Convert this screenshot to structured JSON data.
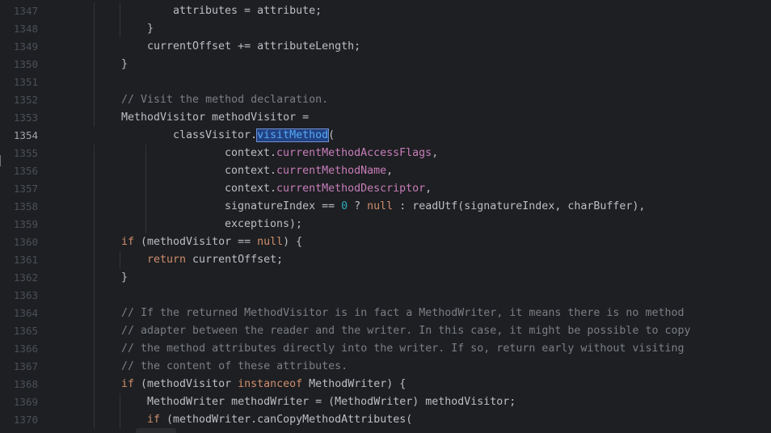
{
  "editor": {
    "current_line": 1354,
    "lines": [
      {
        "num": "1347",
        "indent": 4,
        "tokens": [
          {
            "t": "attributes = attribute;",
            "c": "plain"
          }
        ]
      },
      {
        "num": "1348",
        "indent": 3,
        "tokens": [
          {
            "t": "}",
            "c": "plain"
          }
        ]
      },
      {
        "num": "1349",
        "indent": 3,
        "tokens": [
          {
            "t": "currentOffset += attributeLength;",
            "c": "plain"
          }
        ]
      },
      {
        "num": "1350",
        "indent": 2,
        "tokens": [
          {
            "t": "}",
            "c": "plain"
          }
        ]
      },
      {
        "num": "1351",
        "indent": 0,
        "tokens": []
      },
      {
        "num": "1352",
        "indent": 2,
        "tokens": [
          {
            "t": "// Visit the method declaration.",
            "c": "cmt"
          }
        ]
      },
      {
        "num": "1353",
        "indent": 2,
        "tokens": [
          {
            "t": "MethodVisitor methodVisitor =",
            "c": "plain"
          }
        ]
      },
      {
        "num": "1354",
        "indent": 4,
        "tokens": [
          {
            "t": "classVisitor.",
            "c": "plain"
          },
          {
            "t": "visitMethod",
            "c": "sel"
          },
          {
            "t": "(",
            "c": "plain"
          }
        ]
      },
      {
        "num": "1355",
        "indent": 6,
        "tokens": [
          {
            "t": "context.",
            "c": "plain"
          },
          {
            "t": "currentMethodAccessFlags",
            "c": "field"
          },
          {
            "t": ",",
            "c": "plain"
          }
        ]
      },
      {
        "num": "1356",
        "indent": 6,
        "tokens": [
          {
            "t": "context.",
            "c": "plain"
          },
          {
            "t": "currentMethodName",
            "c": "field"
          },
          {
            "t": ",",
            "c": "plain"
          }
        ]
      },
      {
        "num": "1357",
        "indent": 6,
        "tokens": [
          {
            "t": "context.",
            "c": "plain"
          },
          {
            "t": "currentMethodDescriptor",
            "c": "field"
          },
          {
            "t": ",",
            "c": "plain"
          }
        ]
      },
      {
        "num": "1358",
        "indent": 6,
        "tokens": [
          {
            "t": "signatureIndex == ",
            "c": "plain"
          },
          {
            "t": "0",
            "c": "num"
          },
          {
            "t": " ? ",
            "c": "plain"
          },
          {
            "t": "null",
            "c": "kw"
          },
          {
            "t": " : readUtf(signatureIndex, charBuffer),",
            "c": "plain"
          }
        ]
      },
      {
        "num": "1359",
        "indent": 6,
        "tokens": [
          {
            "t": "exceptions);",
            "c": "plain"
          }
        ]
      },
      {
        "num": "1360",
        "indent": 2,
        "tokens": [
          {
            "t": "if",
            "c": "kw"
          },
          {
            "t": " (methodVisitor == ",
            "c": "plain"
          },
          {
            "t": "null",
            "c": "kw"
          },
          {
            "t": ") {",
            "c": "plain"
          }
        ]
      },
      {
        "num": "1361",
        "indent": 3,
        "tokens": [
          {
            "t": "return",
            "c": "kw"
          },
          {
            "t": " currentOffset;",
            "c": "plain"
          }
        ]
      },
      {
        "num": "1362",
        "indent": 2,
        "tokens": [
          {
            "t": "}",
            "c": "plain"
          }
        ]
      },
      {
        "num": "1363",
        "indent": 0,
        "tokens": []
      },
      {
        "num": "1364",
        "indent": 2,
        "tokens": [
          {
            "t": "// If the returned MethodVisitor is in fact a MethodWriter, it means there is no method",
            "c": "cmt"
          }
        ]
      },
      {
        "num": "1365",
        "indent": 2,
        "tokens": [
          {
            "t": "// adapter between the reader and the writer. In this case, it might be possible to copy",
            "c": "cmt"
          }
        ]
      },
      {
        "num": "1366",
        "indent": 2,
        "tokens": [
          {
            "t": "// the method attributes directly into the writer. If so, return early without visiting",
            "c": "cmt"
          }
        ]
      },
      {
        "num": "1367",
        "indent": 2,
        "tokens": [
          {
            "t": "// the content of these attributes.",
            "c": "cmt"
          }
        ]
      },
      {
        "num": "1368",
        "indent": 2,
        "tokens": [
          {
            "t": "if",
            "c": "kw"
          },
          {
            "t": " (methodVisitor ",
            "c": "plain"
          },
          {
            "t": "instanceof",
            "c": "kw"
          },
          {
            "t": " MethodWriter) {",
            "c": "plain"
          }
        ]
      },
      {
        "num": "1369",
        "indent": 3,
        "tokens": [
          {
            "t": "MethodWriter methodWriter = (MethodWriter) methodVisitor;",
            "c": "plain"
          }
        ]
      },
      {
        "num": "1370",
        "indent": 3,
        "tokens": [
          {
            "t": "if",
            "c": "kw"
          },
          {
            "t": " (methodWriter.canCopyMethodAttributes(",
            "c": "plain"
          }
        ]
      }
    ]
  },
  "colors": {
    "background": "#1e1f22",
    "keyword": "#cf8e6d",
    "field": "#c77dbb",
    "number": "#2aacb8",
    "comment": "#7a7e85",
    "text": "#bcbec4",
    "selection": "#214283"
  }
}
